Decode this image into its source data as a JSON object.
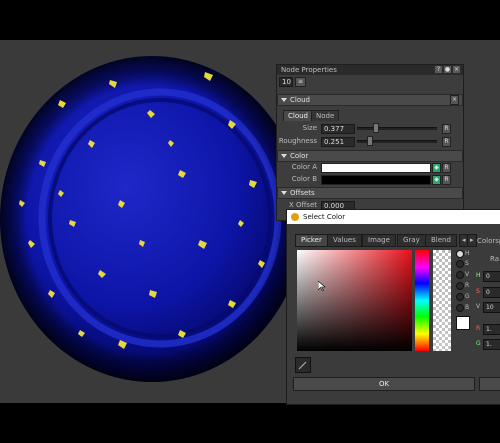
{
  "node_properties": {
    "title": "Node Properties",
    "id_field": "10",
    "section_cloud": "Cloud",
    "tabs": [
      "Cloud",
      "Node"
    ],
    "size": {
      "label": "Size",
      "value": "0.377",
      "r": "R"
    },
    "roughness": {
      "label": "Roughness",
      "value": "0.251",
      "r": "R"
    },
    "section_color": "Color",
    "color_a": {
      "label": "Color A",
      "r": "R",
      "value": "#ffffff"
    },
    "color_b": {
      "label": "Color B",
      "r": "R",
      "value": "#000000"
    },
    "section_offsets": "Offsets",
    "x_offset": {
      "label": "X Offset",
      "value": "0.000"
    }
  },
  "select_color": {
    "title": "Select Color",
    "tabs": [
      "Picker",
      "Values",
      "Image",
      "Gray",
      "Blend"
    ],
    "colorspace_label": "Colorsp",
    "range_label": "Ra",
    "hsv_radios": [
      "H",
      "S",
      "V",
      "R",
      "G",
      "B"
    ],
    "fields": [
      {
        "label": "H",
        "value": "0"
      },
      {
        "label": "S",
        "value": "0"
      },
      {
        "label": "V",
        "value": "10"
      },
      {
        "label": "R",
        "value": "1."
      },
      {
        "label": "G",
        "value": "1."
      }
    ],
    "ok_label": "OK",
    "current_color": "#ffffff"
  }
}
